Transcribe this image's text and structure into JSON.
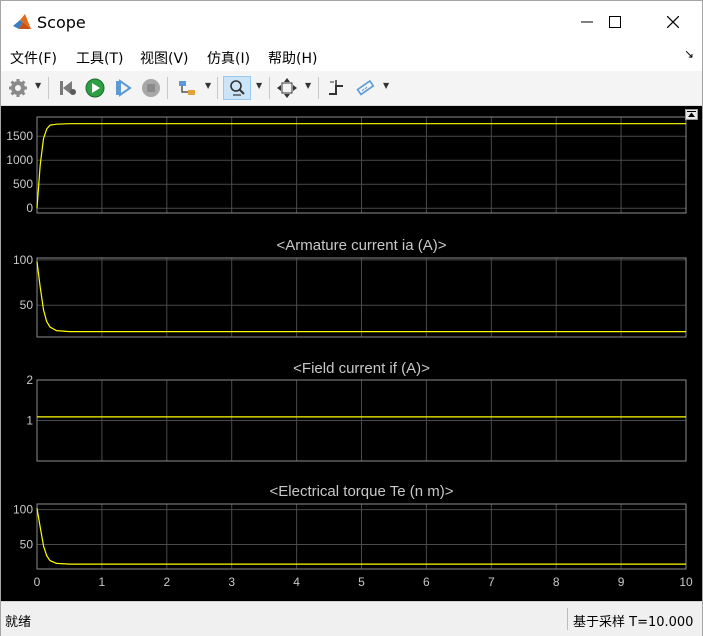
{
  "window": {
    "title": "Scope",
    "minimize_icon": "minimize-icon",
    "maximize_icon": "maximize-icon",
    "close_icon": "close-icon"
  },
  "menu": {
    "items": [
      {
        "label": "文件(F)"
      },
      {
        "label": "工具(T)"
      },
      {
        "label": "视图(V)"
      },
      {
        "label": "仿真(I)"
      },
      {
        "label": "帮助(H)"
      }
    ],
    "collapse_glyph": "↘"
  },
  "toolbar": {
    "icons": [
      "gear-icon",
      "step-back-icon",
      "run-icon",
      "step-forward-icon",
      "stop-icon",
      "signal-select-icon",
      "zoom-icon",
      "autoscale-icon",
      "cursor-measure-icon",
      "style-icon"
    ]
  },
  "colors": {
    "background": "#000000",
    "grid": "#4a4a4a",
    "axis_text": "#c8c8c8",
    "trace": "#ffff00",
    "title_text": "#c8c8c8"
  },
  "status": {
    "left": "就绪",
    "right": "基于采样 T=10.000"
  },
  "chart_data": [
    {
      "type": "line",
      "title": "",
      "xlim": [
        0,
        10
      ],
      "ylim": [
        -100,
        1900
      ],
      "yticks": [
        "0",
        "500",
        "1000",
        "1500"
      ],
      "ytick_values": [
        0,
        500,
        1000,
        1500
      ],
      "xticks": [],
      "grid": true,
      "series": [
        {
          "x": [
            0,
            0.05,
            0.1,
            0.15,
            0.2,
            0.3,
            0.5,
            1,
            10
          ],
          "y": [
            0,
            900,
            1450,
            1650,
            1730,
            1750,
            1760,
            1760,
            1760
          ]
        }
      ]
    },
    {
      "type": "line",
      "title": "<Armature current ia (A)>",
      "xlim": [
        0,
        10
      ],
      "ylim": [
        15,
        102
      ],
      "yticks": [
        "50",
        "100"
      ],
      "ytick_values": [
        50,
        100
      ],
      "xticks": [],
      "grid": true,
      "series": [
        {
          "x": [
            0,
            0.05,
            0.1,
            0.15,
            0.2,
            0.3,
            0.5,
            1,
            10
          ],
          "y": [
            98,
            70,
            45,
            32,
            26,
            22,
            21,
            21,
            21
          ]
        }
      ]
    },
    {
      "type": "line",
      "title": "<Field current if (A)>",
      "xlim": [
        0,
        10
      ],
      "ylim": [
        0,
        2
      ],
      "yticks": [
        "1",
        "2"
      ],
      "ytick_values": [
        1,
        2
      ],
      "xticks": [],
      "grid": true,
      "series": [
        {
          "x": [
            0,
            10
          ],
          "y": [
            1.09,
            1.09
          ]
        }
      ]
    },
    {
      "type": "line",
      "title": "<Electrical torque Te (n m)>",
      "xlim": [
        0,
        10
      ],
      "ylim": [
        15,
        108
      ],
      "yticks": [
        "50",
        "100"
      ],
      "ytick_values": [
        50,
        100
      ],
      "xticks": [
        "0",
        "1",
        "2",
        "3",
        "4",
        "5",
        "6",
        "7",
        "8",
        "9",
        "10"
      ],
      "xtick_values": [
        0,
        1,
        2,
        3,
        4,
        5,
        6,
        7,
        8,
        9,
        10
      ],
      "grid": true,
      "series": [
        {
          "x": [
            0,
            0.05,
            0.1,
            0.15,
            0.2,
            0.3,
            0.5,
            1,
            10
          ],
          "y": [
            102,
            75,
            48,
            34,
            27,
            23,
            22,
            22,
            22
          ]
        }
      ]
    }
  ]
}
